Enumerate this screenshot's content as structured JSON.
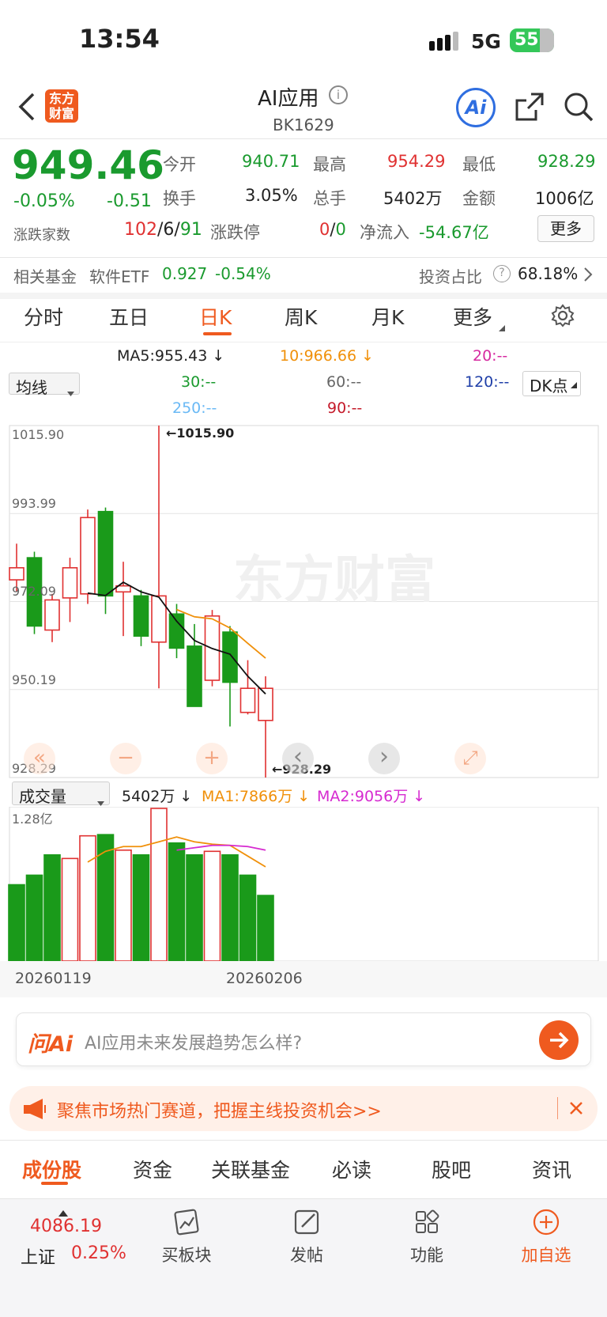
{
  "status_bar": {
    "time": "13:54",
    "network": "5G",
    "battery": "55"
  },
  "header": {
    "logo_line1": "东方",
    "logo_line2": "财富",
    "title": "AI应用",
    "code": "BK1629",
    "ai_label": "Ai"
  },
  "quote": {
    "price": "949.46",
    "change_pct": "-0.05%",
    "change": "-0.51",
    "open_label": "今开",
    "open": "940.71",
    "high_label": "最高",
    "high": "954.29",
    "low_label": "最低",
    "low": "928.29",
    "turnover_label": "换手",
    "turnover": "3.05%",
    "volume_label": "总手",
    "volume": "5402万",
    "amount_label": "金额",
    "amount": "1006亿",
    "breadth_label": "涨跌家数",
    "breadth_up": "102",
    "breadth_flat": "6",
    "breadth_down": "91",
    "limit_label": "涨跌停",
    "limit_up": "0",
    "limit_down": "0",
    "netflow_label": "净流入",
    "netflow": "-54.67亿",
    "more": "更多"
  },
  "fund": {
    "label": "相关基金",
    "name": "软件ETF",
    "price": "0.927",
    "change": "-0.54%",
    "ratio_label": "投资占比",
    "ratio": "68.18%"
  },
  "chart_tabs": [
    "分时",
    "五日",
    "日K",
    "周K",
    "月K",
    "更多"
  ],
  "indicators": {
    "ma_select": "均线",
    "ma5": "MA5:955.43",
    "ma10": "10:966.66",
    "ma20": "20:--",
    "ma30": "30:--",
    "ma60": "60:--",
    "ma120": "120:--",
    "ma250": "250:--",
    "ma90": "90:--",
    "dk": "DK点"
  },
  "volume_header": {
    "select": "成交量",
    "vol": "5402万",
    "ma1": "MA1:7866万",
    "ma2": "MA2:9056万"
  },
  "chart_data": [
    {
      "type": "candlestick",
      "y_ticks": [
        "1015.90",
        "993.99",
        "972.09",
        "950.19",
        "928.29"
      ],
      "ylim": [
        928.29,
        1015.9
      ],
      "max_label": "1015.90",
      "min_label": "928.29",
      "x_labels": [
        "20260119",
        "20260206"
      ],
      "candles": [
        {
          "open": 977.5,
          "close": 980.5,
          "high": 986.5,
          "low": 974.5
        },
        {
          "open": 983.0,
          "close": 966.0,
          "high": 984.5,
          "low": 964.0
        },
        {
          "open": 965.0,
          "close": 972.5,
          "high": 974.0,
          "low": 962.0
        },
        {
          "open": 973.0,
          "close": 980.5,
          "high": 983.0,
          "low": 967.0
        },
        {
          "open": 974.0,
          "close": 993.0,
          "high": 995.0,
          "low": 971.5
        },
        {
          "open": 994.5,
          "close": 973.5,
          "high": 995.5,
          "low": 969.0
        },
        {
          "open": 974.5,
          "close": 976.0,
          "high": 982.0,
          "low": 963.5
        },
        {
          "open": 973.5,
          "close": 963.5,
          "high": 975.0,
          "low": 961.0
        },
        {
          "open": 962.0,
          "close": 973.5,
          "high": 1015.9,
          "low": 950.5
        },
        {
          "open": 969.0,
          "close": 960.5,
          "high": 971.5,
          "low": 958.0
        },
        {
          "open": 961.0,
          "close": 946.0,
          "high": 966.5,
          "low": 946.0
        },
        {
          "open": 952.5,
          "close": 968.5,
          "high": 970.0,
          "low": 951.0
        },
        {
          "open": 964.5,
          "close": 952.0,
          "high": 966.0,
          "low": 941.0
        },
        {
          "open": 944.5,
          "close": 950.5,
          "high": 957.5,
          "low": 944.0
        },
        {
          "open": 942.5,
          "close": 950.5,
          "high": 953.5,
          "low": 928.29
        }
      ],
      "ma5_line": [
        null,
        null,
        null,
        null,
        974.2,
        973.6,
        976.9,
        974.5,
        973.2,
        967.2,
        962.4,
        960.4,
        959.0,
        953.5,
        949.1
      ],
      "ma10_line": [
        null,
        null,
        null,
        null,
        null,
        null,
        null,
        null,
        null,
        970.1,
        968.3,
        967.8,
        965.5,
        961.7,
        958.0
      ]
    },
    {
      "type": "bar",
      "y_ticks": [
        "1.28亿"
      ],
      "ylim": [
        0,
        1.28
      ],
      "values": [
        0.64,
        0.72,
        0.89,
        0.86,
        1.05,
        1.06,
        0.93,
        0.89,
        1.28,
        0.99,
        0.89,
        0.92,
        0.89,
        0.72,
        0.55
      ],
      "rising": [
        false,
        false,
        false,
        true,
        true,
        false,
        true,
        false,
        true,
        false,
        false,
        true,
        false,
        false,
        false
      ],
      "ma1_line": [
        null,
        null,
        null,
        null,
        0.83,
        0.92,
        0.96,
        0.96,
        1.0,
        1.04,
        1.0,
        0.98,
        0.97,
        0.88,
        0.79
      ],
      "ma2_line": [
        null,
        null,
        null,
        null,
        null,
        null,
        null,
        null,
        null,
        0.93,
        0.95,
        0.97,
        0.97,
        0.96,
        0.93
      ]
    }
  ],
  "chart_controls": [
    "«",
    "−",
    "+",
    "‹",
    "›",
    "⤢"
  ],
  "ask_ai": {
    "brand": "问Ai",
    "placeholder": "AI应用未来发展趋势怎么样?"
  },
  "banner": {
    "text": "聚焦市场热门赛道，把握主线投资机会>>"
  },
  "section_tabs": [
    "成份股",
    "资金",
    "关联基金",
    "必读",
    "股吧",
    "资讯"
  ],
  "bottom_nav": {
    "index_value": "4086.19",
    "index_name": "上证",
    "index_change": "0.25%",
    "items": [
      "买板块",
      "发帖",
      "功能",
      "加自选"
    ]
  }
}
